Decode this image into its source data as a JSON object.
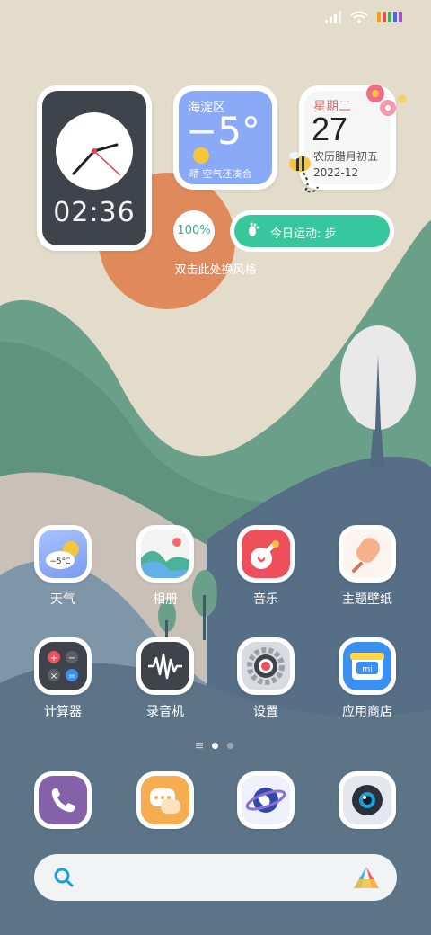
{
  "status": {
    "signal": "signal-icon",
    "wifi": "wifi-icon",
    "battery": "battery-icon"
  },
  "widgets": {
    "clock": {
      "time": "02:36"
    },
    "weather": {
      "location": "海淀区",
      "temperature": "−5°",
      "description": "晴  空气还凑合"
    },
    "calendar": {
      "weekday": "星期二",
      "day": "27",
      "lunar": "农历腊月初五",
      "year_month": "2022-12"
    },
    "battery": {
      "percent": "100%"
    },
    "steps": {
      "label": "今日运动: 步"
    },
    "hint": "双击此处换风格"
  },
  "apps": [
    {
      "label": "天气",
      "icon": "weather-icon",
      "badge": "−5℃"
    },
    {
      "label": "相册",
      "icon": "gallery-icon"
    },
    {
      "label": "音乐",
      "icon": "music-icon"
    },
    {
      "label": "主题壁纸",
      "icon": "themes-icon"
    },
    {
      "label": "计算器",
      "icon": "calculator-icon"
    },
    {
      "label": "录音机",
      "icon": "recorder-icon"
    },
    {
      "label": "设置",
      "icon": "settings-icon"
    },
    {
      "label": "应用商店",
      "icon": "app-store-icon"
    }
  ],
  "dock": [
    {
      "icon": "phone-icon"
    },
    {
      "icon": "messages-icon"
    },
    {
      "icon": "browser-icon"
    },
    {
      "icon": "camera-icon"
    }
  ],
  "search": {
    "icon": "search-icon",
    "assistant": "assistant-icon"
  },
  "colors": {
    "weather_bg": "#8aaaf8",
    "clock_bg": "#3f434c",
    "steps_bg": "#36c89c",
    "sun": "#e08a5c"
  }
}
